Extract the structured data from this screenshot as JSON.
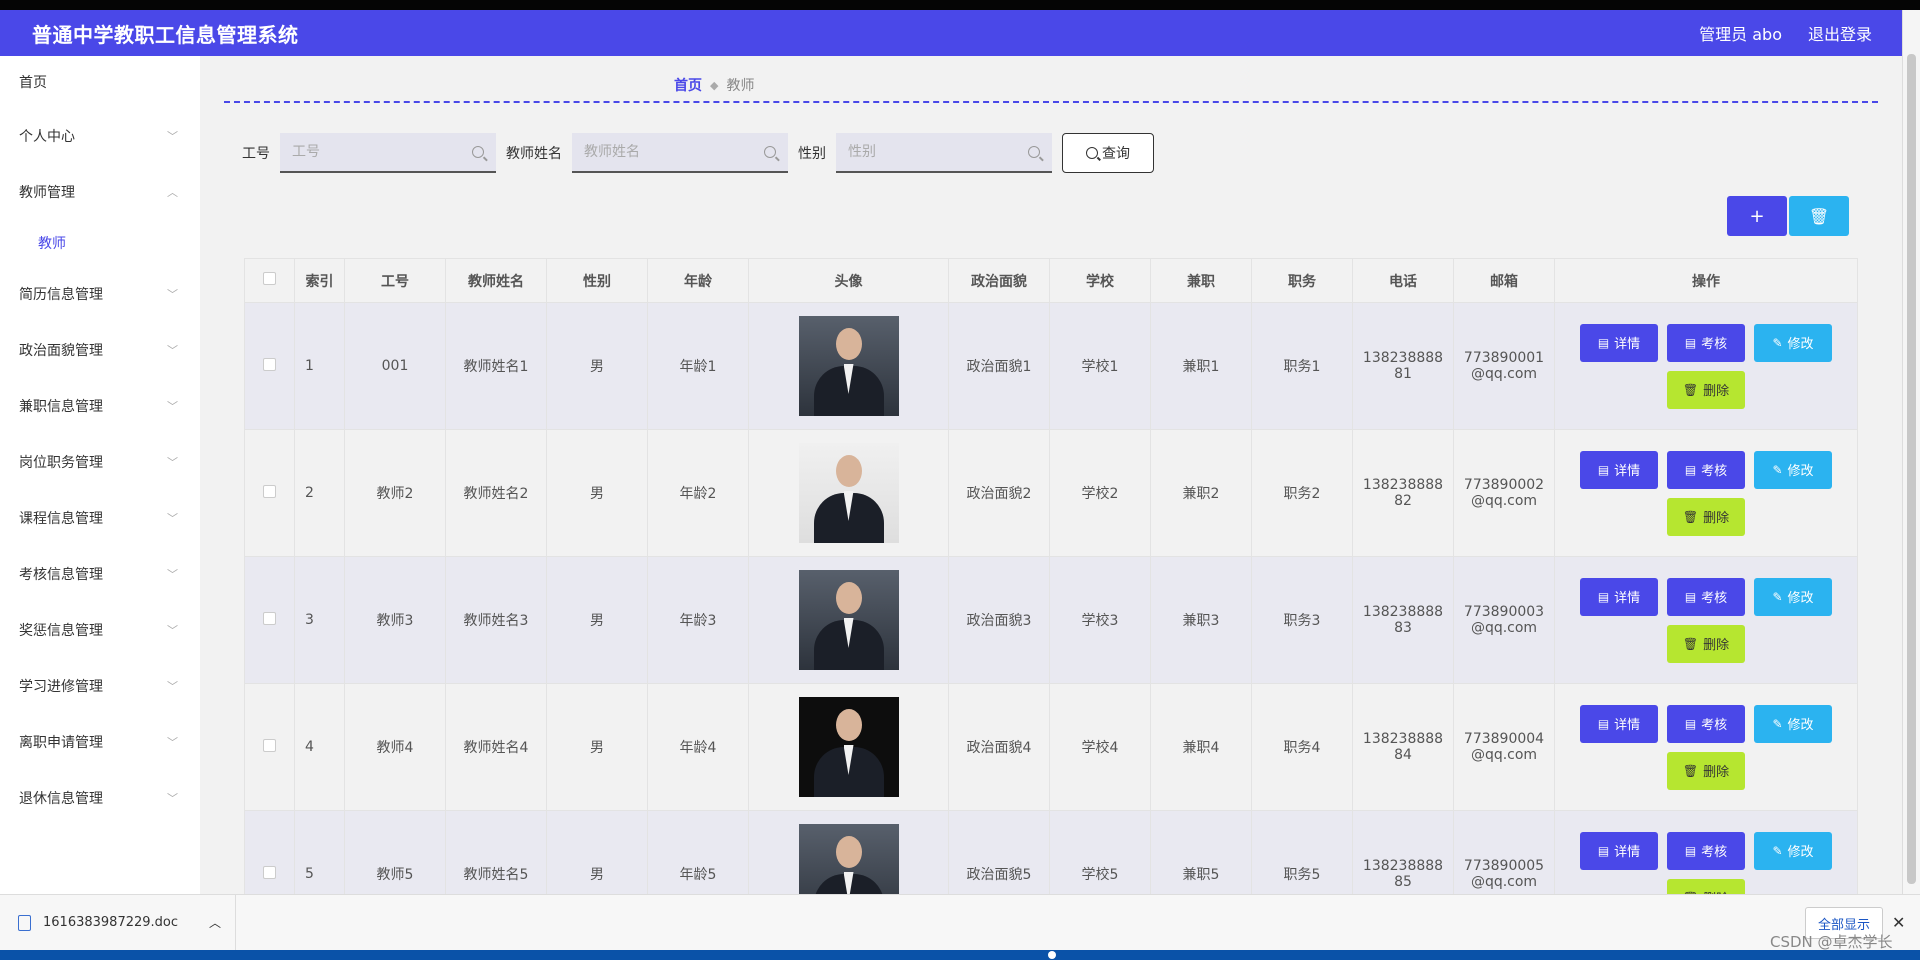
{
  "header": {
    "title": "普通中学教职工信息管理系统",
    "user": "管理员 abo",
    "logout": "退出登录"
  },
  "sidebar": {
    "items": [
      {
        "label": "首页"
      },
      {
        "label": "个人中心"
      },
      {
        "label": "教师管理"
      },
      {
        "label": "教师"
      },
      {
        "label": "简历信息管理"
      },
      {
        "label": "政治面貌管理"
      },
      {
        "label": "兼职信息管理"
      },
      {
        "label": "岗位职务管理"
      },
      {
        "label": "课程信息管理"
      },
      {
        "label": "考核信息管理"
      },
      {
        "label": "奖惩信息管理"
      },
      {
        "label": "学习进修管理"
      },
      {
        "label": "离职申请管理"
      },
      {
        "label": "退休信息管理"
      }
    ]
  },
  "breadcrumb": {
    "home": "首页",
    "current": "教师"
  },
  "search": {
    "fields": [
      {
        "label": "工号",
        "placeholder": "工号"
      },
      {
        "label": "教师姓名",
        "placeholder": "教师姓名"
      },
      {
        "label": "性别",
        "placeholder": "性别"
      }
    ],
    "query_label": "查询"
  },
  "actions": {
    "add": "+"
  },
  "table": {
    "headers": [
      "索引",
      "工号",
      "教师姓名",
      "性别",
      "年龄",
      "头像",
      "政治面貌",
      "学校",
      "兼职",
      "职务",
      "电话",
      "邮箱",
      "操作"
    ],
    "rows": [
      {
        "index": "1",
        "id": "001",
        "name": "教师姓名1",
        "gender": "男",
        "age": "年龄1",
        "politics": "政治面貌1",
        "school": "学校1",
        "parttime": "兼职1",
        "position": "职务1",
        "phone1": "138238888",
        "phone2": "81",
        "email1": "773890001",
        "email2": "@qq.com"
      },
      {
        "index": "2",
        "id": "教师2",
        "name": "教师姓名2",
        "gender": "男",
        "age": "年龄2",
        "politics": "政治面貌2",
        "school": "学校2",
        "parttime": "兼职2",
        "position": "职务2",
        "phone1": "138238888",
        "phone2": "82",
        "email1": "773890002",
        "email2": "@qq.com"
      },
      {
        "index": "3",
        "id": "教师3",
        "name": "教师姓名3",
        "gender": "男",
        "age": "年龄3",
        "politics": "政治面貌3",
        "school": "学校3",
        "parttime": "兼职3",
        "position": "职务3",
        "phone1": "138238888",
        "phone2": "83",
        "email1": "773890003",
        "email2": "@qq.com"
      },
      {
        "index": "4",
        "id": "教师4",
        "name": "教师姓名4",
        "gender": "男",
        "age": "年龄4",
        "politics": "政治面貌4",
        "school": "学校4",
        "parttime": "兼职4",
        "position": "职务4",
        "phone1": "138238888",
        "phone2": "84",
        "email1": "773890004",
        "email2": "@qq.com"
      },
      {
        "index": "5",
        "id": "教师5",
        "name": "教师姓名5",
        "gender": "男",
        "age": "年龄5",
        "politics": "政治面貌5",
        "school": "学校5",
        "parttime": "兼职5",
        "position": "职务5",
        "phone1": "138238888",
        "phone2": "85",
        "email1": "773890005",
        "email2": "@qq.com"
      }
    ],
    "ops": {
      "detail": "详情",
      "review": "考核",
      "edit": "修改",
      "delete": "删除"
    }
  },
  "download": {
    "filename": "1616383987229.doc",
    "show_all": "全部显示",
    "watermark": "CSDN @卓杰学长"
  },
  "icons": {
    "doc": "doc-icon",
    "search": "search-icon",
    "trash": "trash-icon",
    "edit": "edit-icon",
    "close": "close-icon",
    "chevron": "chevron-down-icon"
  },
  "colors": {
    "primary": "#4a48e8",
    "info": "#2bb3f0",
    "lime": "#b6e630"
  }
}
